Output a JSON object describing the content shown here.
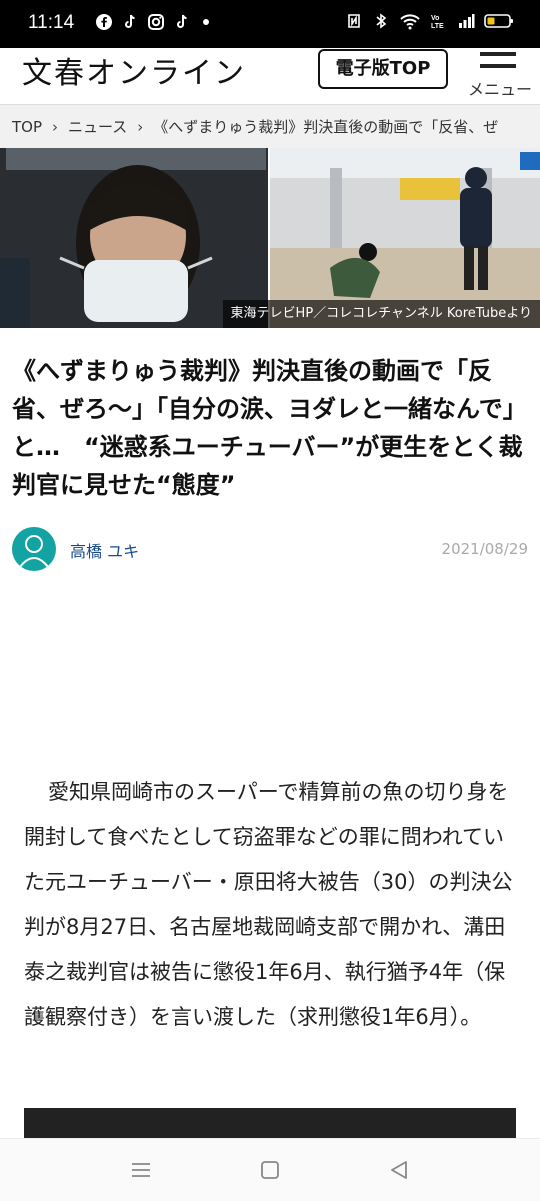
{
  "status_bar": {
    "time": "11:14",
    "left_icons": [
      "facebook-icon",
      "tiktok-icon",
      "instagram-icon",
      "tiktok-icon"
    ],
    "right_icons": [
      "nfc-icon",
      "bluetooth-icon",
      "wifi-icon",
      "volte-icon",
      "signal-icon",
      "battery-icon"
    ]
  },
  "header": {
    "logo_text": "文春オンライン",
    "top_button_label": "電子版TOP",
    "menu_label": "メニュー"
  },
  "breadcrumb": {
    "items": [
      "TOP",
      "ニュース",
      "《へずまりゅう裁判》判決直後の動画で「反省、ぜ"
    ]
  },
  "hero": {
    "caption": "東海テレビHP／コレコレチャンネル KoreTubeより"
  },
  "article": {
    "title": "《へずまりゅう裁判》判決直後の動画で「反省、ぜろ〜」「自分の涙、ヨダレと一緒なんで」と…　“迷惑系ユーチューバー”が更生をとく裁判官に見せた“態度”",
    "author": "高橋 ユキ",
    "date": "2021/08/29",
    "body": "愛知県岡崎市のスーパーで精算前の魚の切り身を開封して食べたとして窃盗罪などの罪に問われていた元ユーチューバー・原田将大被告（30）の判決公判が8月27日、名古屋地裁岡崎支部で開かれ、溝田泰之裁判官は被告に懲役1年6月、執行猶予4年（保護観察付き）を言い渡した（求刑懲役1年6月）。"
  },
  "nav_bar": {
    "buttons": [
      "recents-icon",
      "home-icon",
      "back-icon"
    ]
  },
  "colors": {
    "status_bar_bg": "#000000",
    "breadcrumb_bg": "#f1f1f1",
    "author_link": "#1a4a8a",
    "avatar_bg": "#14a3a3"
  }
}
